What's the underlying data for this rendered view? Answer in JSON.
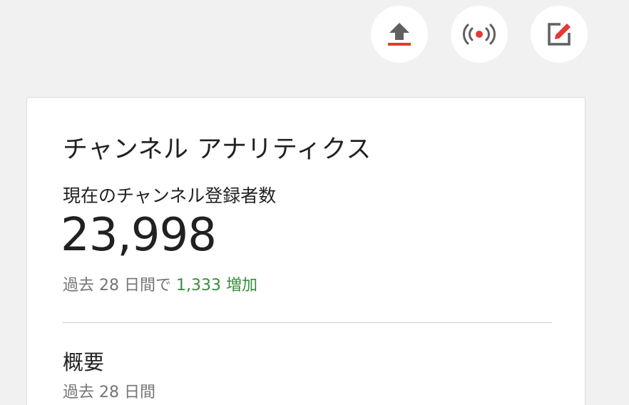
{
  "actions": {
    "upload_icon": "upload-icon",
    "live_icon": "live-broadcast-icon",
    "create_icon": "edit-post-icon"
  },
  "colors": {
    "background": "#f1f1f1",
    "card": "#ffffff",
    "accent_red": "#e53935",
    "icon_gray": "#606060",
    "gain_green": "#388e3c"
  },
  "card": {
    "title": "チャンネル アナリティクス",
    "subscribers_label": "現在のチャンネル登録者数",
    "subscribers_count": "23,998",
    "change_prefix": "過去 28 日間で",
    "change_value": "1,333 増加",
    "overview_title": "概要",
    "overview_period": "過去 28 日間"
  }
}
